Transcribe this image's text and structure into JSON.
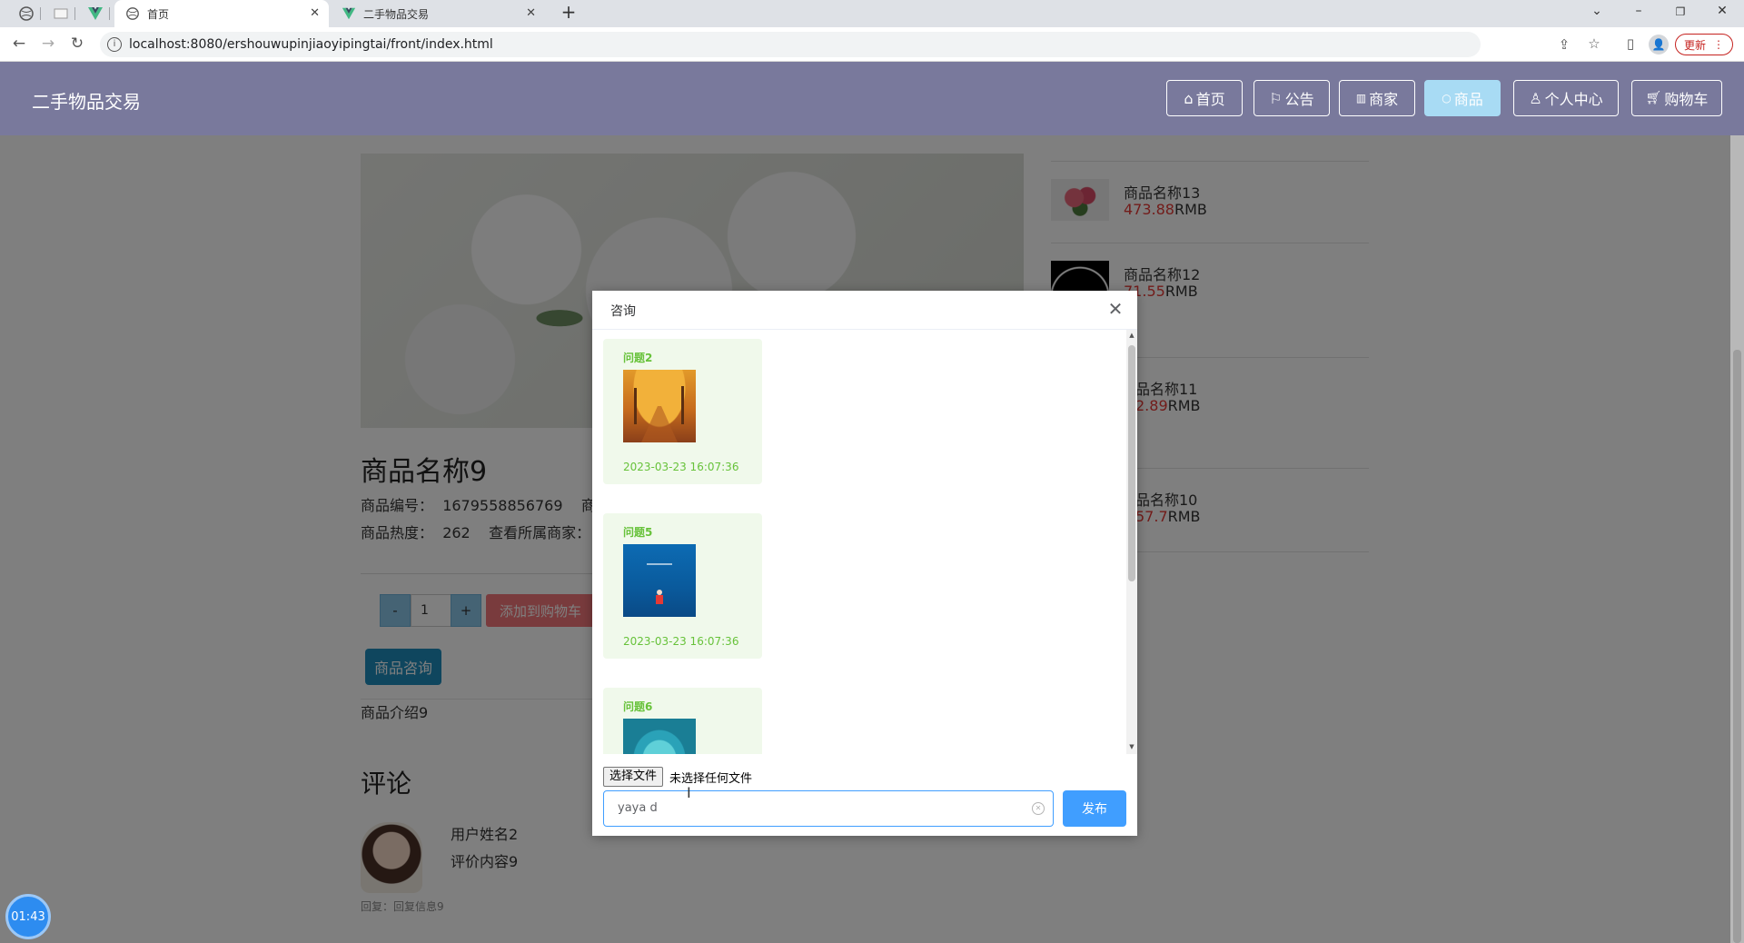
{
  "browser": {
    "tabs": [
      {
        "title": "首页",
        "active": true
      },
      {
        "title": "二手物品交易",
        "active": false
      }
    ],
    "url": "localhost:8080/ershouwupinjiaoyipingtai/front/index.html",
    "update_label": "更新"
  },
  "site": {
    "title": "二手物品交易",
    "nav": [
      {
        "icon": "home-icon",
        "label": "首页"
      },
      {
        "icon": "flag-icon",
        "label": "公告"
      },
      {
        "icon": "shop-icon",
        "label": "商家"
      },
      {
        "icon": "chat-icon",
        "label": "商品"
      },
      {
        "icon": "user-icon",
        "label": "个人中心"
      },
      {
        "icon": "cart-icon",
        "label": "购物车"
      }
    ]
  },
  "product": {
    "name": "商品名称9",
    "code_label": "商品编号：",
    "code_value": "1679558856769",
    "code_extra": "商品",
    "heat_label": "商品热度：",
    "heat_value": "262",
    "shop_link": "查看所属商家：",
    "qty_minus": "-",
    "qty_value": "1",
    "qty_plus": "+",
    "add_cart": "添加到购物车",
    "consult": "商品咨询",
    "intro": "商品介绍9"
  },
  "comments": {
    "title": "评论",
    "user": "用户姓名2",
    "content": "评价内容9",
    "reply": "回复：回复信息9"
  },
  "recommend": [
    {
      "name": "商品名称13",
      "price": "473.88",
      "unit": "RMB"
    },
    {
      "name": "商品名称12",
      "price": "71.55",
      "unit": "RMB"
    },
    {
      "name": "品名称11",
      "price": "2.89",
      "unit": "RMB"
    },
    {
      "name": "品名称10",
      "price": "57.7",
      "unit": "RMB"
    }
  ],
  "dialog": {
    "title": "咨询",
    "messages": [
      {
        "question": "问题2",
        "time": "2023-03-23 16:07:36"
      },
      {
        "question": "问题5",
        "time": "2023-03-23 16:07:36"
      },
      {
        "question": "问题6",
        "time": ""
      }
    ],
    "file_button": "选择文件",
    "file_status": "未选择任何文件",
    "input_value": "yaya d",
    "send": "发布"
  },
  "timer": "01:43"
}
